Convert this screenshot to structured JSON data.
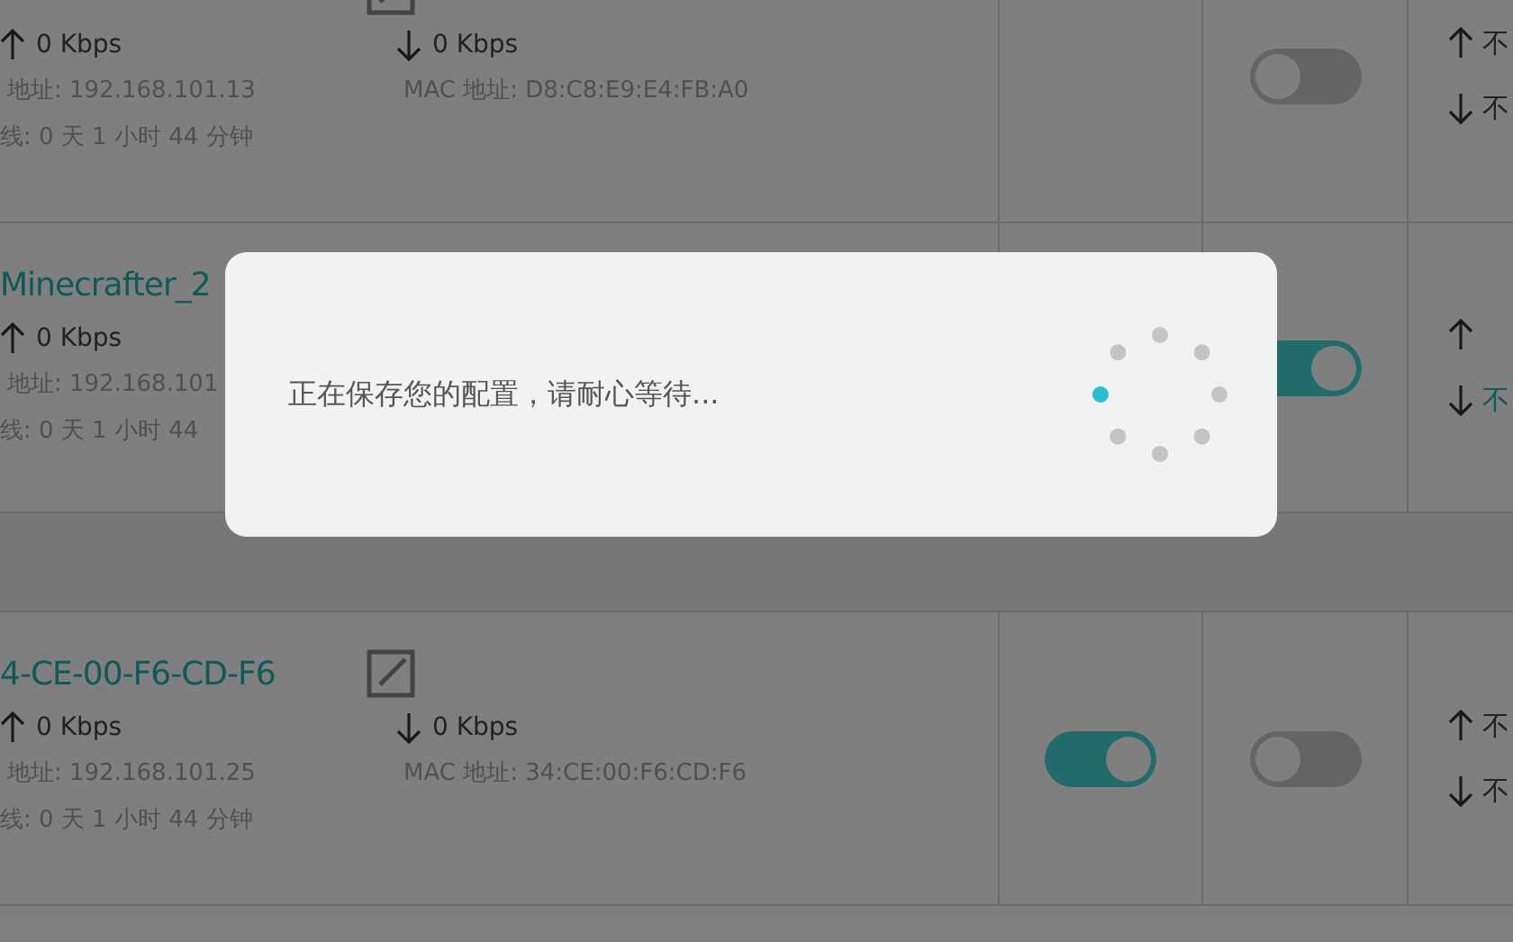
{
  "devices": [
    {
      "edit_icon": true,
      "up": "0 Kbps",
      "down": "0 Kbps",
      "ip": "地址: 192.168.101.13",
      "mac": "MAC 地址: D8:C8:E9:E4:FB:A0",
      "online": "线: 0 天 1 小时 44 分钟",
      "switch_b": {
        "on": false
      },
      "rates": [
        {
          "kind": "up",
          "text": "不",
          "active": false
        },
        {
          "kind": "down",
          "text": "不",
          "active": false
        }
      ]
    },
    {
      "name": "Minecrafter_2",
      "edit_icon": false,
      "up": "0 Kbps",
      "ip": "地址: 192.168.101",
      "online": "线: 0 天 1 小时 44",
      "switch_b": {
        "on": true
      },
      "rates": [
        {
          "kind": "up"
        },
        {
          "kind": "down",
          "text": "不",
          "active": true
        }
      ]
    },
    {
      "name": "4-CE-00-F6-CD-F6",
      "edit_icon": true,
      "up": "0 Kbps",
      "down": "0 Kbps",
      "ip": "地址: 192.168.101.25",
      "mac": "MAC 地址: 34:CE:00:F6:CD:F6",
      "online": "线: 0 天 1 小时 44 分钟",
      "switch_a": {
        "on": true
      },
      "switch_b": {
        "on": false
      },
      "rates": [
        {
          "kind": "up",
          "text": "不",
          "active": false
        },
        {
          "kind": "down",
          "text": "不",
          "active": false
        }
      ]
    }
  ],
  "dialog": {
    "message": "正在保存您的配置，请耐心等待..."
  }
}
